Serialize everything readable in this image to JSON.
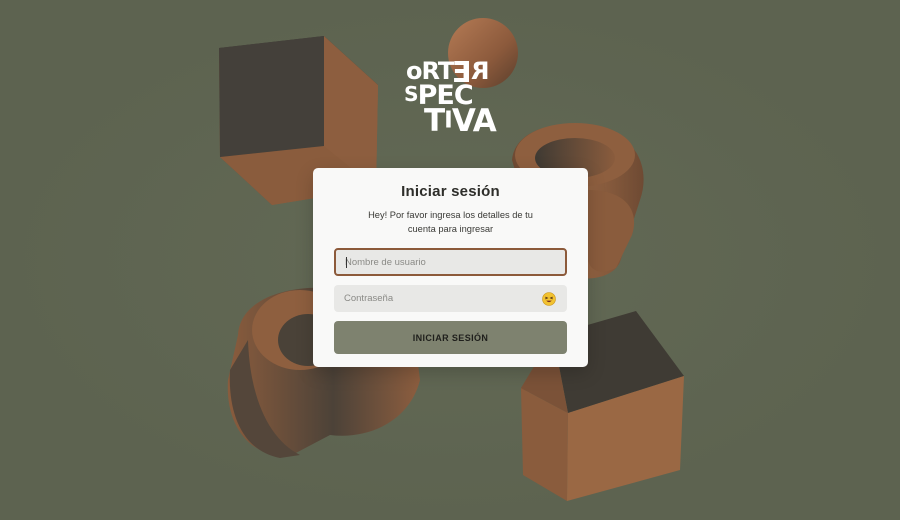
{
  "brand": {
    "logo_name": "Otra Perspectiva",
    "logo_lines": [
      "oRTER",
      "SPECTI",
      "TIVA"
    ]
  },
  "login": {
    "title": "Iniciar sesión",
    "subtitle": "Hey! Por favor ingresa los detalles de tu cuenta para ingresar",
    "username_placeholder": "Nombre de usuario",
    "password_placeholder": "Contraseña",
    "password_toggle_icon": "emoji-face-eye-toggle-icon",
    "submit_label": "INICIAR SESIÓN"
  },
  "colors": {
    "background": "#5d6350",
    "card": "#f9f9f8",
    "focus_border": "#8c5a3a",
    "button": "#7e826f",
    "shape_light": "#8a5c3f",
    "shape_dark": "#46423a"
  }
}
